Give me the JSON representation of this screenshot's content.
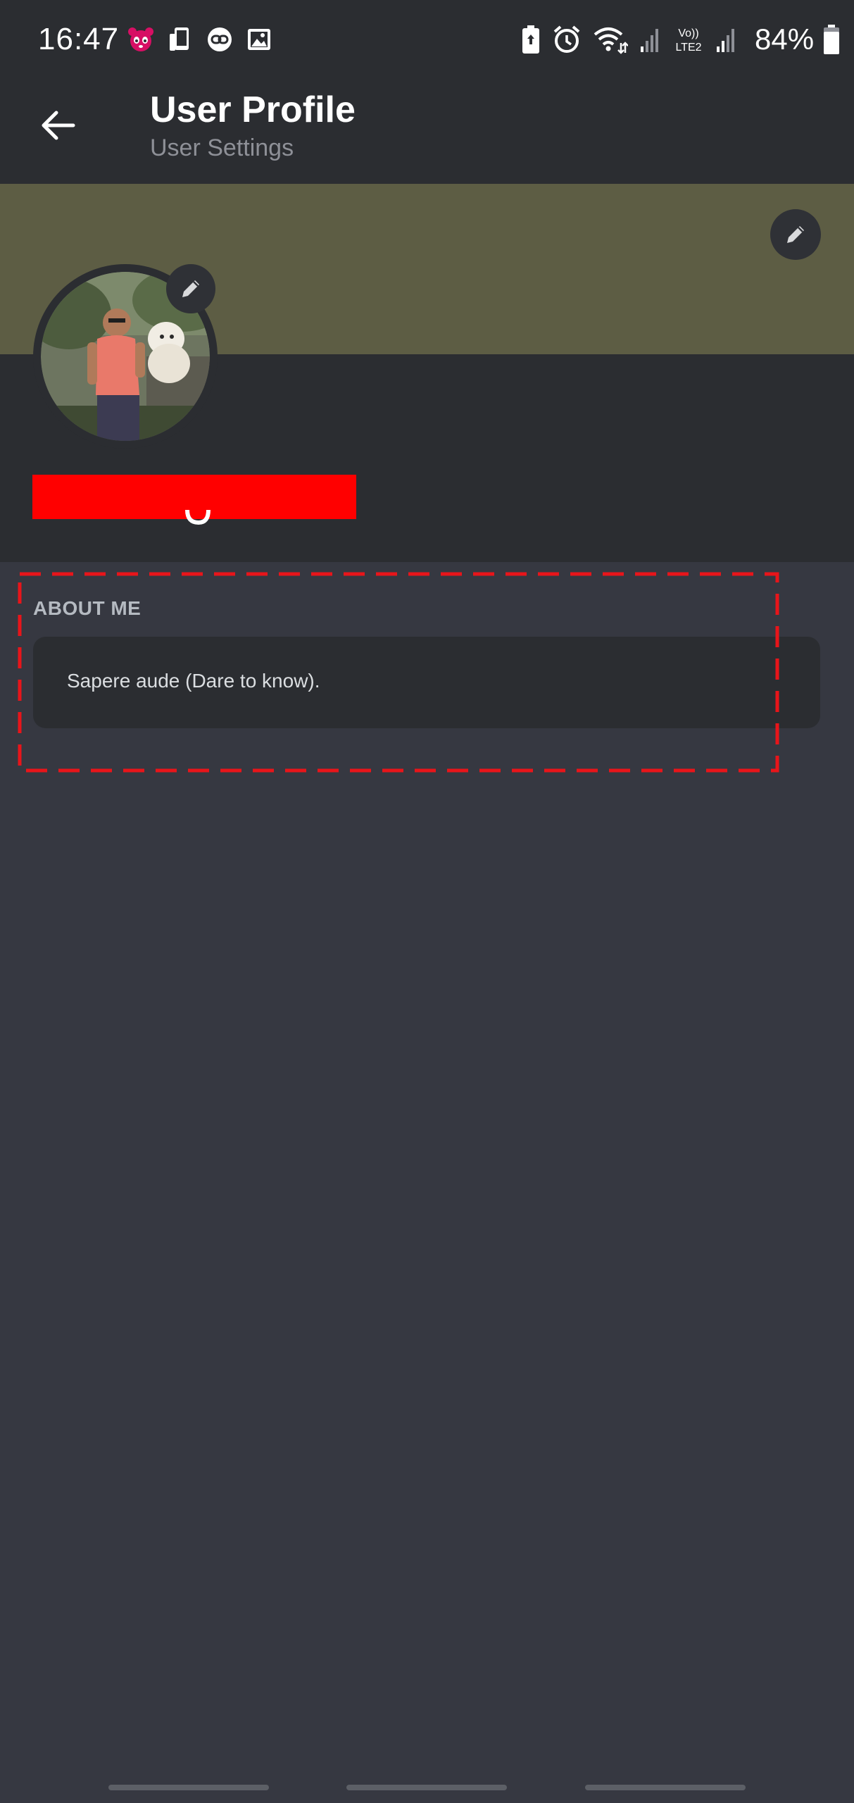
{
  "status_bar": {
    "time": "16:47",
    "left_icons": [
      "panda-app-icon",
      "phone-transfer-icon",
      "link-app-icon",
      "gallery-icon"
    ],
    "right_icons": [
      "battery-saver-icon",
      "alarm-icon",
      "wifi-icon",
      "signal-1-icon",
      "volte-lte2-icon",
      "signal-2-icon"
    ],
    "volte_text_top": "Vo))",
    "volte_text_bottom": "LTE2",
    "battery_percent": "84%",
    "battery_level": 0.84
  },
  "header": {
    "title": "User Profile",
    "subtitle": "User Settings",
    "back_icon": "arrow-left-icon"
  },
  "profile": {
    "banner_color": "#5d5d44",
    "banner_edit_icon": "pencil-icon",
    "avatar_edit_icon": "pencil-icon",
    "username_redaction_color": "#ff0000"
  },
  "about": {
    "heading": "ABOUT ME",
    "text": "Sapere aude (Dare to know).",
    "highlight_color": "#e8151a"
  },
  "colors": {
    "background": "#363841",
    "surface": "#2b2d31",
    "text_primary": "#ffffff",
    "text_secondary": "#8e9097"
  }
}
